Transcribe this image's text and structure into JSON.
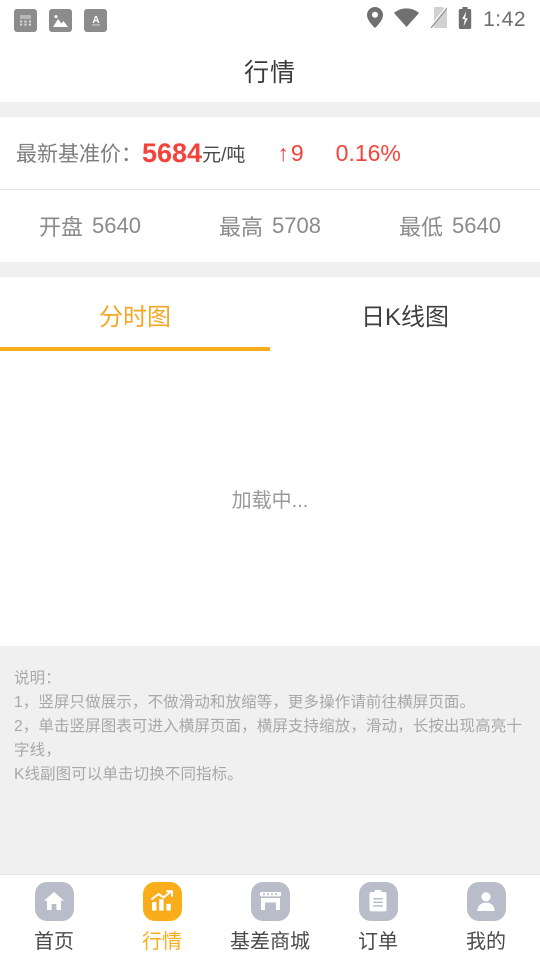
{
  "statusbar": {
    "time": "1:42",
    "left_icons": [
      "calculator-notification-icon",
      "image-notification-icon",
      "text-notification-icon"
    ],
    "right_icons": [
      "location-icon",
      "wifi-icon",
      "sim-off-icon",
      "battery-charging-icon"
    ]
  },
  "header": {
    "title": "行情"
  },
  "quote": {
    "label": "最新基准价：",
    "price": "5684",
    "unit": "元/吨",
    "arrow": "↑",
    "change": "9",
    "percent": "0.16%",
    "up_color": "#f4433a"
  },
  "stats": [
    {
      "name": "open",
      "label": "开盘",
      "value": "5640"
    },
    {
      "name": "high",
      "label": "最高",
      "value": "5708"
    },
    {
      "name": "low",
      "label": "最低",
      "value": "5640"
    }
  ],
  "tabs": [
    {
      "label": "分时图",
      "active": true
    },
    {
      "label": "日K线图",
      "active": false
    }
  ],
  "chart": {
    "loading_text": "加载中...",
    "accent_color": "#f9ad1a"
  },
  "notes": {
    "line1": "说明：",
    "line2": "1，竖屏只做展示，不做滑动和放缩等，更多操作请前往横屏页面。",
    "line3": " 2，单击竖屏图表可进入横屏页面，横屏支持缩放，滑动，长按出现高亮十字线，",
    "line4": "K线副图可以单击切换不同指标。"
  },
  "bottomnav": [
    {
      "label": "首页",
      "icon": "home-icon",
      "active": false
    },
    {
      "label": "行情",
      "icon": "chart-icon",
      "active": true
    },
    {
      "label": "基差商城",
      "icon": "store-icon",
      "active": false
    },
    {
      "label": "订单",
      "icon": "clipboard-icon",
      "active": false
    },
    {
      "label": "我的",
      "icon": "person-icon",
      "active": false
    }
  ]
}
